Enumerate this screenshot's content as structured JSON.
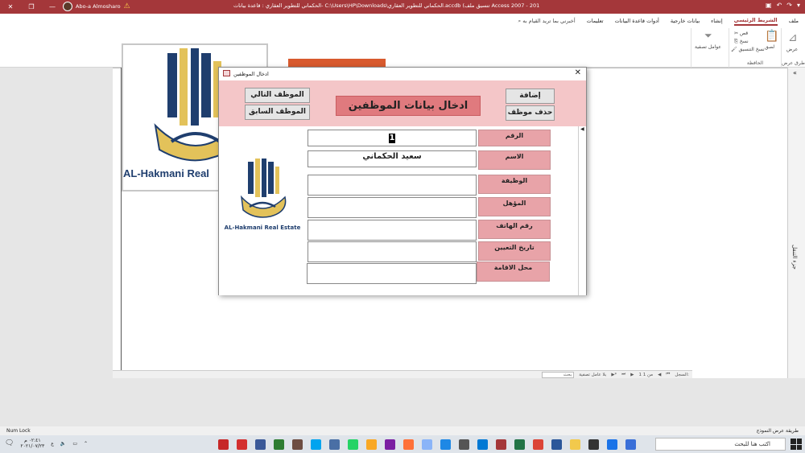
{
  "window": {
    "title": "الحكماني للتطوير العقاري : قاعدة بيانات- C:\\Users\\HP\\Downloads\\الحكماني للتطوير العقاري.accdb (تنسيق ملف Access 2007 - 2016) - Access",
    "user_name": "Abo-a Almosharo"
  },
  "ribbon": {
    "tabs": [
      "ملف",
      "الشريط الرئيسي",
      "إنشاء",
      "بيانات خارجية",
      "أدوات قاعدة البيانات",
      "تعليمات"
    ],
    "active_tab": "الشريط الرئيسي",
    "tellme": "أخبرني بما تريد القيام به",
    "groups": {
      "views": {
        "label": "طرق عرض",
        "item": "عرض"
      },
      "clipboard": {
        "label": "الحافظة",
        "paste": "لصق",
        "cut": "قص",
        "copy": "نسخ",
        "format_painter": "نسخ التنسيق"
      },
      "sort": {
        "item": "عوامل تصفية"
      }
    }
  },
  "report": {
    "logo_caption": "AL-Hakmani Real"
  },
  "right_pane": {
    "label": "جزء التنقل"
  },
  "nav_bar": {
    "record_label": "السجل:",
    "record_pos": "1 من 1",
    "filter": "بلا عامل تصفية",
    "search": "بحث"
  },
  "dialog": {
    "title": "ادخال الموظفين",
    "header_title": "ادخال بيانات الموظفين",
    "buttons": {
      "next": "الموظف التالي",
      "previous": "الموظف السابق",
      "add": "إضافة موظف",
      "delete": "حذف موظف"
    },
    "logo_caption": "AL-Hakmani Real Estate",
    "fields": [
      {
        "label": "الرقم",
        "value": "1"
      },
      {
        "label": "الاسم",
        "value": "سعيد الحكماني"
      },
      {
        "label": "الوظيفة",
        "value": ""
      },
      {
        "label": "المؤهل",
        "value": ""
      },
      {
        "label": "رقم الهاتف",
        "value": ""
      },
      {
        "label": "تاريخ التعيين",
        "value": ""
      },
      {
        "label": "محل الاقامة",
        "value": ""
      }
    ]
  },
  "status_bar": {
    "left": "Num Lock",
    "right": "طريقة عرض النموذج"
  },
  "taskbar": {
    "search_placeholder": "اكتب هنا للبحث",
    "time": "٠٢:٤١ م",
    "date": "٢٠٢١/٠٧/٢٣",
    "lang": "ع"
  },
  "colors": {
    "access_red": "#a4373a",
    "header_pink": "#f4c6c8",
    "label_pink": "#e8a3a8",
    "title_box": "#e07a7e"
  }
}
